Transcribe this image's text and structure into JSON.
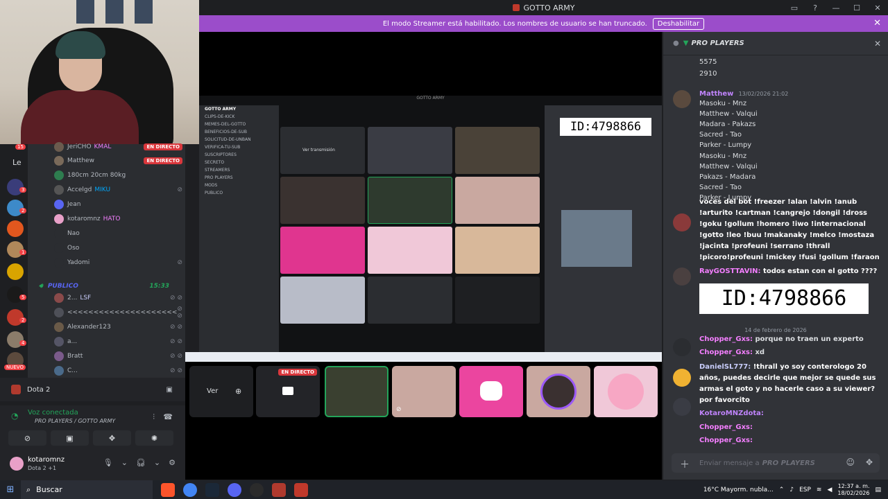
{
  "window": {
    "title": "GOTTO ARMY"
  },
  "banner": {
    "text": "El modo Streamer está habilitado. Los nombres de usuario se han truncado.",
    "button": "Deshabilitar"
  },
  "rail": {
    "badges": [
      "15",
      "Le",
      "3",
      "2",
      "1",
      "5",
      "2",
      "4",
      "NUEVO"
    ]
  },
  "members": [
    {
      "name": "JeriCHO",
      "tag": "KMAL",
      "status": "EN DIRECTO"
    },
    {
      "name": "Matthew",
      "tag": "",
      "status": "EN DIRECTO"
    },
    {
      "name": "180cm 20cm 80kg",
      "tag": "",
      "status": ""
    },
    {
      "name": "Accelgd",
      "tag": "MIKU",
      "status": "muted"
    },
    {
      "name": "Jean",
      "tag": "",
      "status": ""
    },
    {
      "name": "kotaromnz",
      "tag": "HATO",
      "status": ""
    },
    {
      "name": "Nao",
      "tag": "",
      "status": ""
    },
    {
      "name": "Oso",
      "tag": "",
      "status": ""
    },
    {
      "name": "Yadomi",
      "tag": "",
      "status": "muted"
    }
  ],
  "category": {
    "name": "PUBLICO",
    "time": "15:33"
  },
  "public_members": [
    {
      "name": "2...",
      "tag": "LSF"
    },
    {
      "name": "<<<<<<<<<<<<<<<<<<<<<",
      "tag": ""
    },
    {
      "name": "Alexander123",
      "tag": ""
    },
    {
      "name": "a...",
      "tag": ""
    },
    {
      "name": "Bratt",
      "tag": ""
    },
    {
      "name": "C...",
      "tag": ""
    }
  ],
  "activity": {
    "game": "Dota 2"
  },
  "voice": {
    "status": "Voz conectada",
    "channel": "PRO PLAYERS / GOTTO ARMY"
  },
  "user": {
    "name": "kotaromnz",
    "status": "Dota 2 +1"
  },
  "stage": {
    "ver_label": "Ver",
    "live_badge": "EN DIRECTO",
    "inner_title": "GOTTO ARMY",
    "inner_id": "ID:4798866",
    "inner_channels": [
      "GOTTO ARMY",
      "CLIPS-DE-KICK",
      "MEMES-DEL-GOTTO",
      "BENEFICIOS-DE-SUB",
      "SOLICITUD-DE-UNBAN",
      "VERIFICA-TU-SUB",
      "SUSCRIPTORES",
      "SECRETO",
      "STREAMERS",
      "PRO PLAYERS",
      "MODS",
      "PUBLICO"
    ],
    "inner_view": "Ver transmisión"
  },
  "chat": {
    "title": "PRO PLAYERS",
    "lines_top": [
      "5575",
      "2910"
    ],
    "msg1": {
      "author": "Matthew",
      "time": "13/02/2026 21:02",
      "lines": [
        "Masoku - Mnz",
        "Matthew - Valqui",
        "Madara - Pakazs",
        "Sacred - Tao",
        "Parker - Lumpy",
        "Masoku - Mnz",
        "Matthew - Valqui",
        "Pakazs - Madara",
        "Sacred - Tao",
        "Parker - Lumpy"
      ]
    },
    "overlay_text": "voces del bot !freezer !alan !alvin !anub !arturito !cartman !cangrejo !dongil !dross !goku !gollum !homero !iwo !internacional !gotto !leo !buu !makanaky !melco !mostaza !jacinta !profeuni !serrano !thrall !picoro!profeuni !mickey !fusi !gollum !faraon",
    "overlay_q": "todos estan con el gotto ????",
    "overlay_id": "ID:4798866",
    "date_divider": "14 de febrero de 2026",
    "msgs": [
      {
        "author": "Chopper_Gxs:",
        "text": "porque no traen un experto"
      },
      {
        "author": "Chopper_Gxs:",
        "text": "xd"
      },
      {
        "author": "DanielSL777:",
        "text": "!thrall yo soy conterologo 20 años, puedes decirle que mejor se quede sus armas el goto y no hacerle caso a su viewer? por favorcito"
      },
      {
        "author": "KotaroMNZdota:",
        "text": ""
      },
      {
        "author": "Chopper_Gxs:",
        "text": ""
      },
      {
        "author": "Chopper_Gxs:",
        "text": ""
      }
    ],
    "placeholder": "Enviar mensaje a",
    "placeholder_channel": "PRO PLAYERS"
  },
  "taskbar": {
    "search": "Buscar",
    "weather": "16°C  Mayorm. nubla...",
    "lang": "ESP",
    "time": "12:37 a. m.",
    "date": "18/02/2026"
  }
}
